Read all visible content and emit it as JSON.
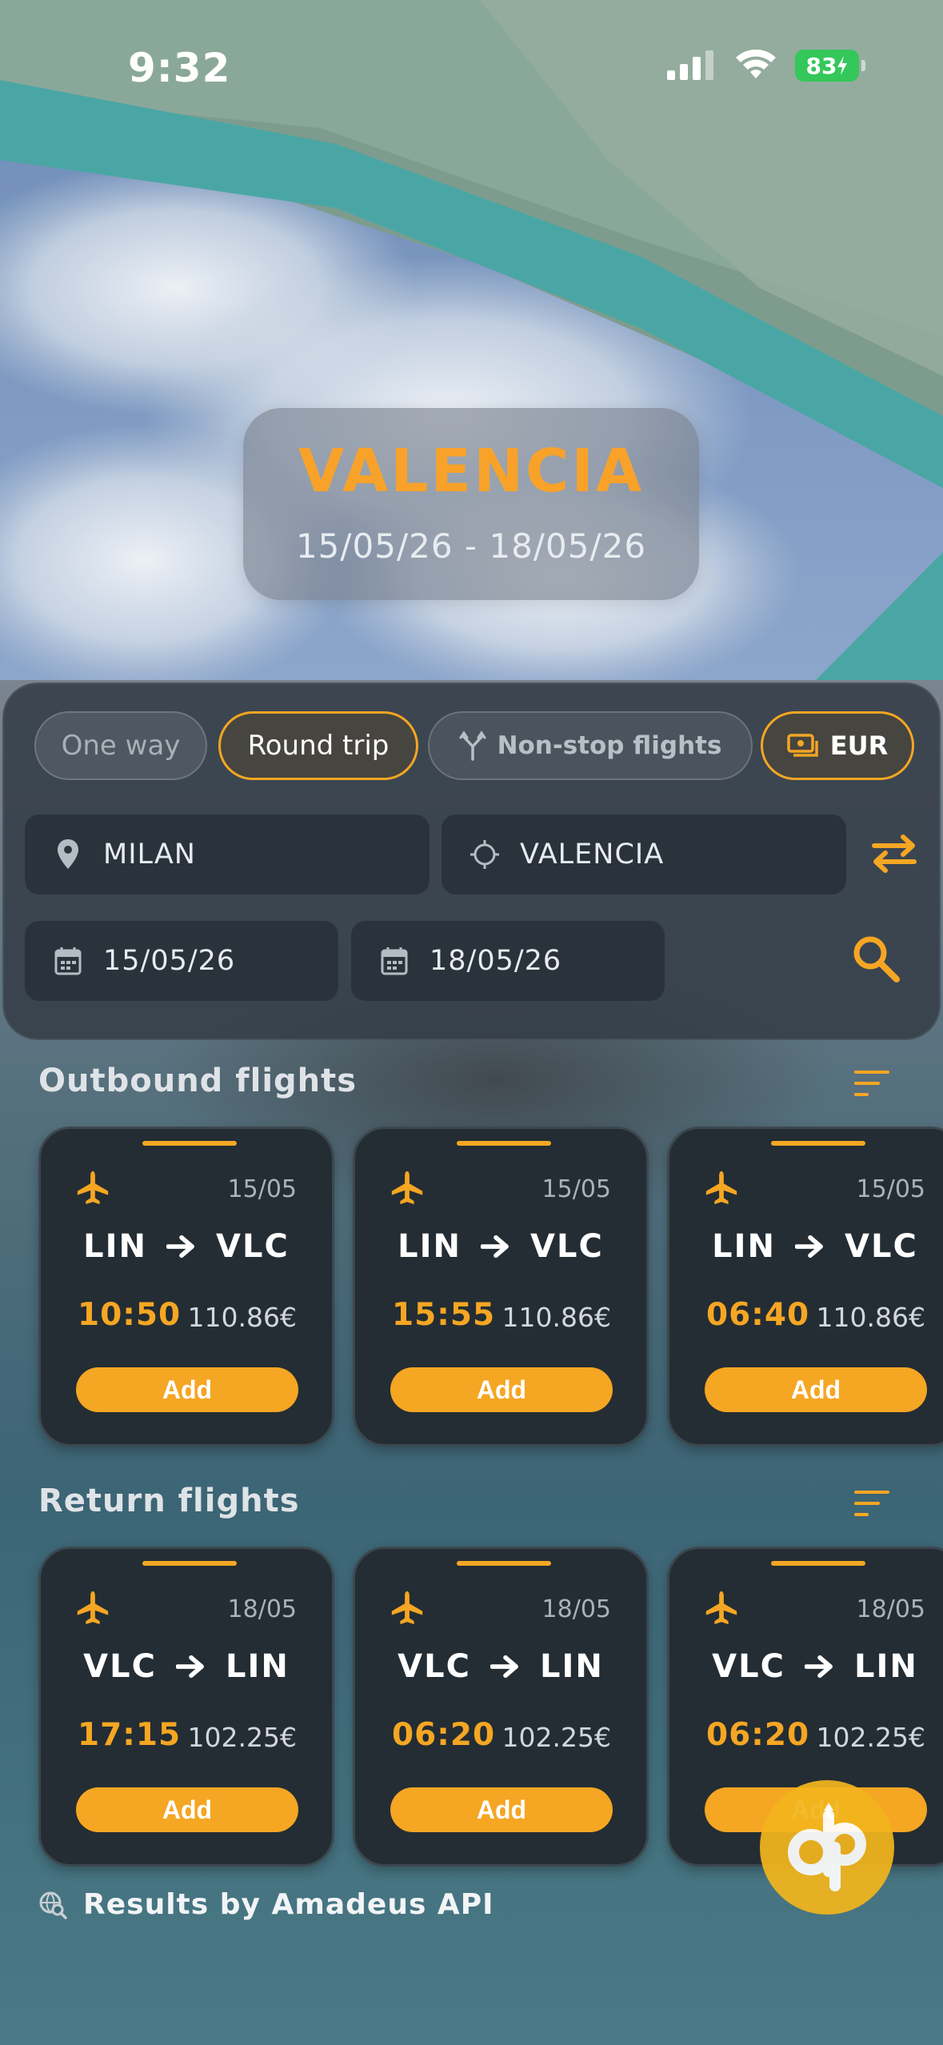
{
  "status_bar": {
    "time": "9:32",
    "battery": "83"
  },
  "destination": {
    "city": "VALENCIA",
    "dates": "15/05/26 - 18/05/26"
  },
  "search": {
    "trip_types": {
      "one_way": "One way",
      "round_trip": "Round trip",
      "selected": "Round trip"
    },
    "nonstop_label": "Non-stop flights",
    "currency": "EUR",
    "origin": "MILAN",
    "destination": "VALENCIA",
    "departure_date": "15/05/26",
    "return_date": "18/05/26"
  },
  "outbound": {
    "title": "Outbound flights",
    "flights": [
      {
        "date": "15/05",
        "from": "LIN",
        "to": "VLC",
        "time": "10:50",
        "price": "110.86€",
        "action": "Add"
      },
      {
        "date": "15/05",
        "from": "LIN",
        "to": "VLC",
        "time": "15:55",
        "price": "110.86€",
        "action": "Add"
      },
      {
        "date": "15/05",
        "from": "LIN",
        "to": "VLC",
        "time": "06:40",
        "price": "110.86€",
        "action": "Add"
      }
    ]
  },
  "return": {
    "title": "Return flights",
    "flights": [
      {
        "date": "18/05",
        "from": "VLC",
        "to": "LIN",
        "time": "17:15",
        "price": "102.25€",
        "action": "Add"
      },
      {
        "date": "18/05",
        "from": "VLC",
        "to": "LIN",
        "time": "06:20",
        "price": "102.25€",
        "action": "Add"
      },
      {
        "date": "18/05",
        "from": "VLC",
        "to": "LIN",
        "time": "06:20",
        "price": "102.25€",
        "action": "Add"
      }
    ]
  },
  "footer": {
    "text": "Results by Amadeus API"
  },
  "colors": {
    "accent": "#f5a623",
    "card_bg": "#242d33",
    "battery": "#34c759"
  },
  "icons": [
    "location-pin-icon",
    "crosshair-icon",
    "swap-icon",
    "calendar-icon",
    "search-icon",
    "sort-icon",
    "airplane-icon",
    "fork-icon",
    "money-icon",
    "globe-search-icon"
  ]
}
